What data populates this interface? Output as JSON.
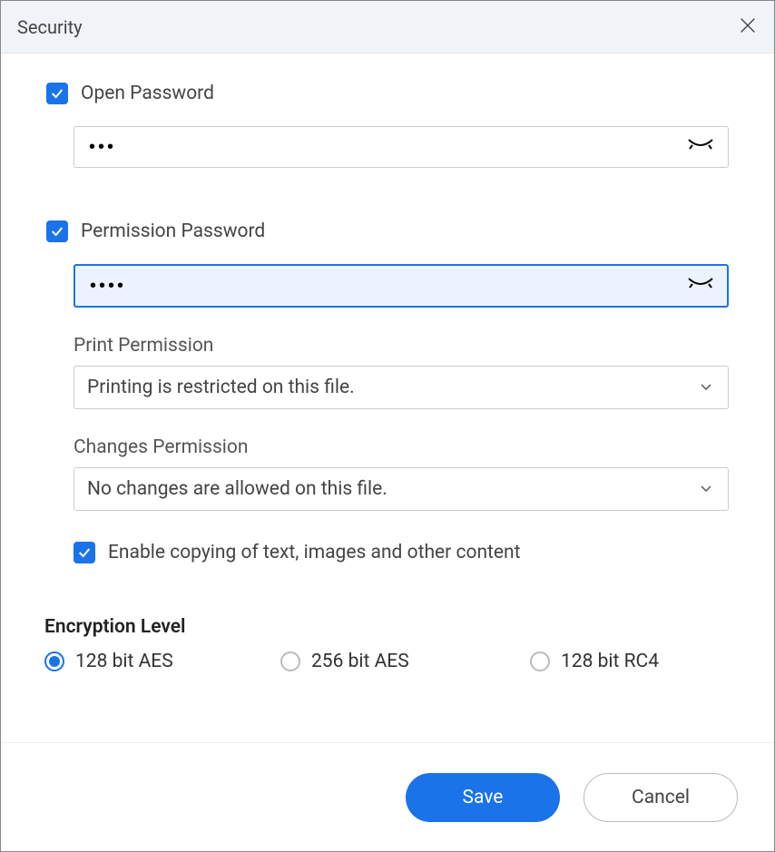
{
  "dialog": {
    "title": "Security"
  },
  "openPassword": {
    "checked": true,
    "label": "Open Password",
    "value": "•••"
  },
  "permissionPassword": {
    "checked": true,
    "label": "Permission Password",
    "value": "••••",
    "printLabel": "Print Permission",
    "printValue": "Printing is restricted on this file.",
    "changesLabel": "Changes Permission",
    "changesValue": "No changes are allowed on this file.",
    "copyChecked": true,
    "copyLabel": "Enable copying of text, images and other content"
  },
  "encryption": {
    "title": "Encryption Level",
    "options": [
      {
        "label": "128 bit AES",
        "selected": true
      },
      {
        "label": "256 bit AES",
        "selected": false
      },
      {
        "label": "128 bit RC4",
        "selected": false
      }
    ]
  },
  "buttons": {
    "save": "Save",
    "cancel": "Cancel"
  }
}
